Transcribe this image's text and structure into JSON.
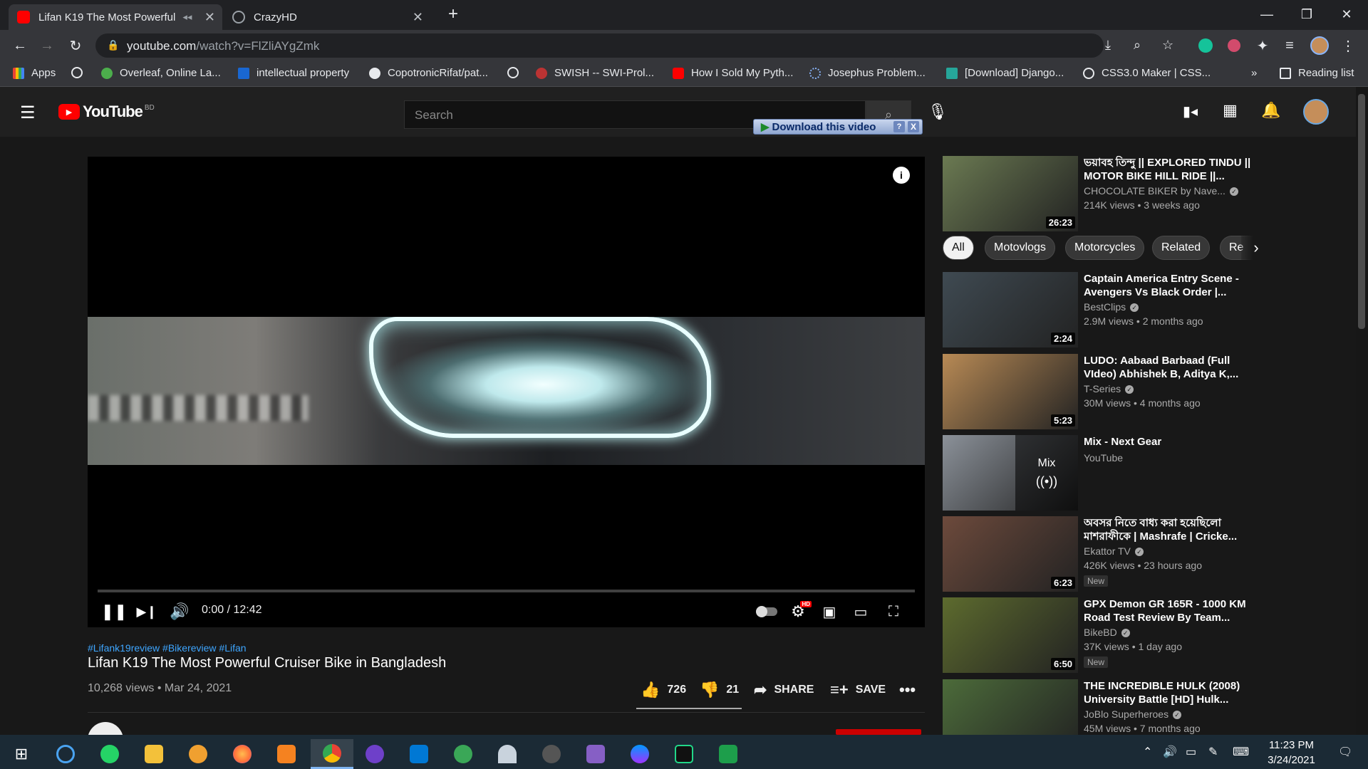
{
  "browser": {
    "tabs": [
      {
        "title": "Lifan K19 The Most Powerful",
        "active": true
      },
      {
        "title": "CrazyHD",
        "active": false
      }
    ],
    "url_host": "youtube.com",
    "url_path": "/watch?v=FlZliAYgZmk",
    "bookmarks": [
      "Apps",
      "Overleaf, Online La...",
      "intellectual property",
      "CopotronicRifat/pat...",
      "SWISH -- SWI-Prol...",
      "How I Sold My Pyth...",
      "Josephus Problem...",
      "[Download] Django...",
      "CSS3.0 Maker | CSS...",
      "Reading list"
    ],
    "more": "»"
  },
  "youtube": {
    "logo_text": "YouTube",
    "country_code": "BD",
    "search_placeholder": "Search",
    "download_bar": "Download this video",
    "download_help": "?",
    "download_close": "X",
    "player": {
      "time": "0:00 / 12:42",
      "progress": 0,
      "hd_badge": "HD",
      "info_icon": "i"
    },
    "video": {
      "hashtags": "#Lifank19review #Bikereview #Lifan",
      "title": "Lifan K19 The Most Powerful Cruiser Bike in Bangladesh",
      "meta": "10,268 views • Mar 24, 2021",
      "likes": "726",
      "dislikes": "21",
      "share": "SHARE",
      "save": "SAVE",
      "like_ratio": 0.97
    },
    "chips": [
      "All",
      "Motovlogs",
      "Motorcycles",
      "Related",
      "Re"
    ],
    "recommendations": [
      {
        "title": "ভয়াবহ তিন্দু || EXPLORED TINDU || MOTOR BIKE HILL RIDE ||...",
        "channel": "CHOCOLATE BIKER by Nave...",
        "verified": true,
        "views": "214K views • 3 weeks ago",
        "duration": "26:23",
        "is_new": false,
        "thumb_color": "#6b7a52"
      },
      {
        "title": "Captain America Entry Scene - Avengers Vs Black Order |...",
        "channel": "BestClips",
        "verified": true,
        "views": "2.9M views • 2 months ago",
        "duration": "2:24",
        "is_new": false,
        "thumb_color": "#3f4a52"
      },
      {
        "title": "LUDO: Aabaad Barbaad (Full VIdeo) Abhishek B, Aditya K,...",
        "channel": "T-Series",
        "verified": true,
        "views": "30M views • 4 months ago",
        "duration": "5:23",
        "is_new": false,
        "thumb_color": "#b88a55"
      },
      {
        "title": "Mix - Next Gear",
        "channel": "YouTube",
        "verified": false,
        "views": "",
        "duration": "",
        "mix_label": "Mix",
        "is_new": false,
        "thumb_color": "#8b9199"
      },
      {
        "title": "অবসর নিতে বাধ্য করা হয়েছিলো মাশরাফীকে | Mashrafe | Cricke...",
        "channel": "Ekattor TV",
        "verified": true,
        "views": "426K views • 23 hours ago",
        "duration": "6:23",
        "is_new": true,
        "new_label": "New",
        "thumb_color": "#6d4a3c"
      },
      {
        "title": "GPX Demon GR 165R - 1000 KM Road Test Review By Team...",
        "channel": "BikeBD",
        "verified": true,
        "views": "37K views • 1 day ago",
        "duration": "6:50",
        "is_new": true,
        "new_label": "New",
        "thumb_color": "#5d6b2e"
      },
      {
        "title": "THE INCREDIBLE HULK (2008) University Battle [HD] Hulk...",
        "channel": "JoBlo Superheroes",
        "verified": true,
        "views": "45M views • 7 months ago",
        "duration": "",
        "is_new": false,
        "thumb_color": "#4c6b3a"
      }
    ]
  },
  "taskbar": {
    "time": "11:23 PM",
    "date": "3/24/2021"
  },
  "colors": {
    "youtube_red": "#ff0000",
    "link_blue": "#3ea6ff",
    "taskbar": "#1b2a35"
  }
}
